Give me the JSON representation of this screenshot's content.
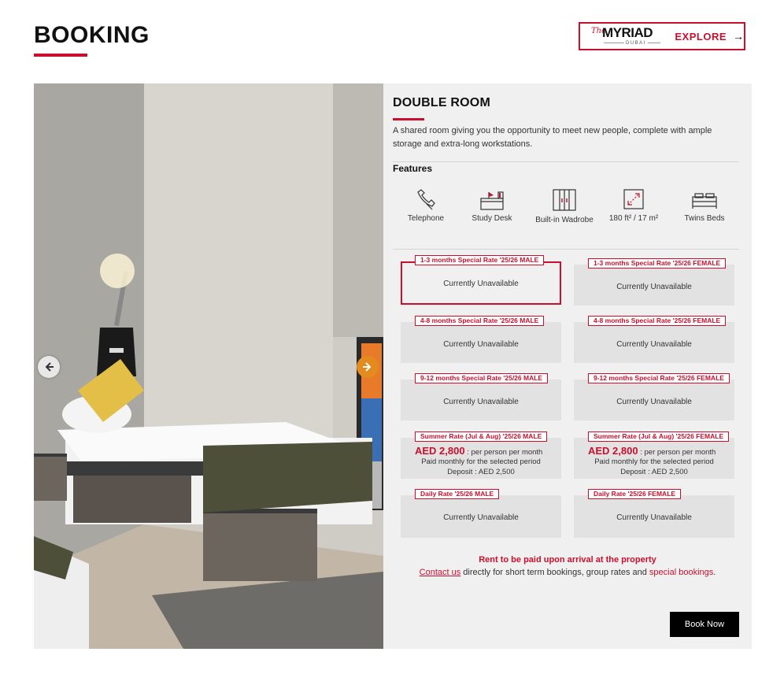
{
  "header": {
    "title": "BOOKING",
    "brand": {
      "prefix": "The",
      "name": "MYRIAD",
      "sub": "DUBAI"
    },
    "explore_label": "EXPLORE",
    "explore_arrow": "→"
  },
  "gallery": {
    "prev_icon": "arrow-left-icon",
    "next_icon": "arrow-right-icon"
  },
  "room": {
    "title": "DOUBLE ROOM",
    "description": "A shared room giving you the opportunity to meet new people, complete with ample storage and extra-long workstations.",
    "features_heading": "Features",
    "features": [
      {
        "label": "Telephone",
        "icon": "telephone-icon"
      },
      {
        "label": "Study Desk",
        "icon": "study-desk-icon"
      },
      {
        "label": "Built-in Wadrobe",
        "icon": "wardrobe-icon"
      },
      {
        "label": "180 ft² / 17 m²",
        "icon": "room-size-icon"
      },
      {
        "label": "Twins Beds",
        "icon": "twin-beds-icon"
      }
    ]
  },
  "rates": [
    {
      "label": "1-3 months Special Rate '25/26 MALE",
      "status": "Currently Unavailable",
      "selected": true
    },
    {
      "label": "1-3 months Special Rate '25/26 FEMALE",
      "status": "Currently Unavailable"
    },
    {
      "label": "4-8 months Special Rate '25/26 MALE",
      "status": "Currently Unavailable"
    },
    {
      "label": "4-8 months Special Rate '25/26 FEMALE",
      "status": "Currently Unavailable"
    },
    {
      "label": "9-12 months Special Rate '25/26 MALE",
      "status": "Currently Unavailable"
    },
    {
      "label": "9-12 months Special Rate '25/26 FEMALE",
      "status": "Currently Unavailable"
    },
    {
      "label": "Summer Rate (Jul & Aug) '25/26 MALE",
      "price": "AED 2,800",
      "price_unit": ": per person per month",
      "note1": "Paid monthly for the selected period",
      "note2": "Deposit : AED 2,500"
    },
    {
      "label": "Summer Rate (Jul & Aug) '25/26 FEMALE",
      "price": "AED 2,800",
      "price_unit": ": per person per month",
      "note1": "Paid monthly for the selected period",
      "note2": "Deposit : AED 2,500"
    },
    {
      "label": "Daily Rate '25/26 MALE",
      "status": "Currently Unavailable"
    },
    {
      "label": "Daily Rate '25/26 FEMALE",
      "status": "Currently Unavailable"
    }
  ],
  "footer": {
    "rent_note": "Rent to be paid upon arrival at the property",
    "contact_link": "Contact us",
    "contact_text": " directly for short term bookings, group rates and ",
    "special_link": "special bookings",
    "contact_end": ".",
    "book_label": "Book Now"
  },
  "colors": {
    "accent": "#c8102e",
    "panel": "#f0f0f0",
    "card": "#e2e2e2",
    "button": "#000000"
  }
}
